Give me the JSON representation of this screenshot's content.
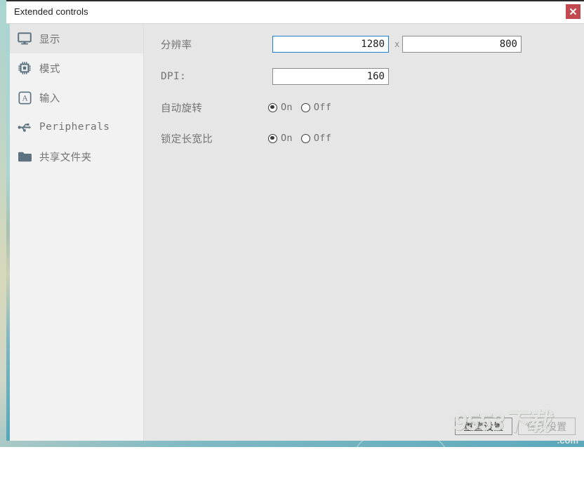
{
  "window": {
    "title": "Extended controls",
    "close_icon": "close-x-icon"
  },
  "sidebar": {
    "items": [
      {
        "label": "显示",
        "icon": "monitor-icon",
        "selected": true
      },
      {
        "label": "模式",
        "icon": "cpu-chip-icon",
        "selected": false
      },
      {
        "label": "输入",
        "icon": "keyboard-a-icon",
        "selected": false
      },
      {
        "label": "Peripherals",
        "icon": "usb-icon",
        "selected": false
      },
      {
        "label": "共享文件夹",
        "icon": "folder-icon",
        "selected": false
      }
    ]
  },
  "content": {
    "resolution": {
      "label": "分辨率",
      "width_value": "1280",
      "height_value": "800",
      "separator": "x",
      "focused_field": "width"
    },
    "dpi": {
      "label": "DPI:",
      "value": "160"
    },
    "auto_rotate": {
      "label": "自动旋转",
      "options": [
        "On",
        "Off"
      ],
      "selected": "On"
    },
    "lock_aspect_ratio": {
      "label": "锁定长宽比",
      "options": [
        "On",
        "Off"
      ],
      "selected": "On"
    }
  },
  "footer": {
    "reset_label": "重置设置",
    "save_label": "保存设置",
    "save_disabled": true
  },
  "watermark": {
    "main": "9553下载",
    "sub": ".com"
  },
  "colors": {
    "accent_blue": "#1d7fd1",
    "close_red": "#c2494f",
    "sidebar_bg": "#f2f2f2",
    "content_bg": "#e6e6e6",
    "icon_slate": "#5c7280",
    "text_gray": "#737373"
  }
}
